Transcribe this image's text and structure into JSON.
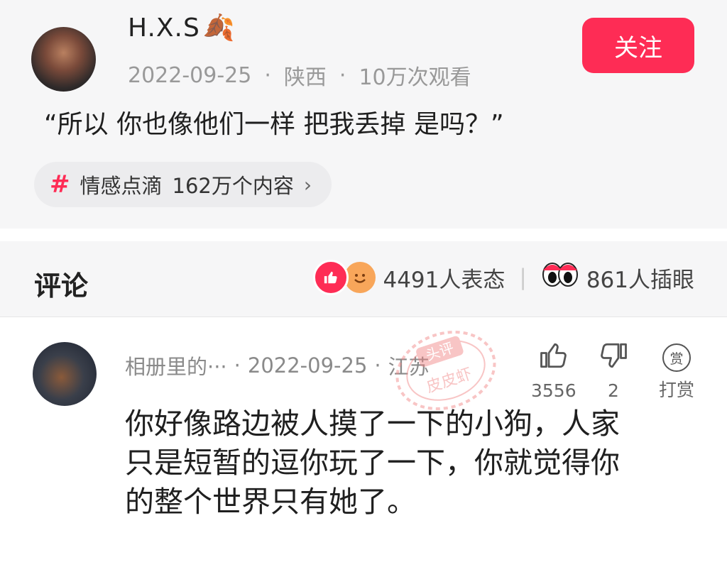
{
  "post": {
    "author_name": "H.X.S",
    "author_emoji": "🍂",
    "date": "2022-09-25",
    "location": "陕西",
    "views": "10万次观看",
    "dot": "·",
    "follow_label": "关注",
    "text": "“所以 你也像他们一样 把我丢掉 是吗？”",
    "topic": {
      "hash": "#",
      "name": "情感点滴",
      "count": "162万个内容",
      "chevron": "›"
    }
  },
  "comments_section": {
    "title": "评论",
    "reactions_count": "4491人表态",
    "separator": "|",
    "eyes_count": "861人插眼"
  },
  "comment": {
    "author": "相册里的···",
    "date": "2022-09-25",
    "location": "江苏",
    "dot": "·",
    "likes": "3556",
    "dislikes": "2",
    "reward_icon_text": "赏",
    "reward_label": "打赏",
    "lines": [
      "你好像路边被人摸了一下的小狗，人家",
      "只是短暂的逗你玩了一下，你就觉得你",
      "的整个世界只有她了。"
    ]
  },
  "watermark": {
    "text_top": "头评",
    "text_main": "皮皮虾"
  },
  "colors": {
    "accent": "#fe2c55",
    "background": "#f6f6f7",
    "muted_text": "#999999"
  }
}
